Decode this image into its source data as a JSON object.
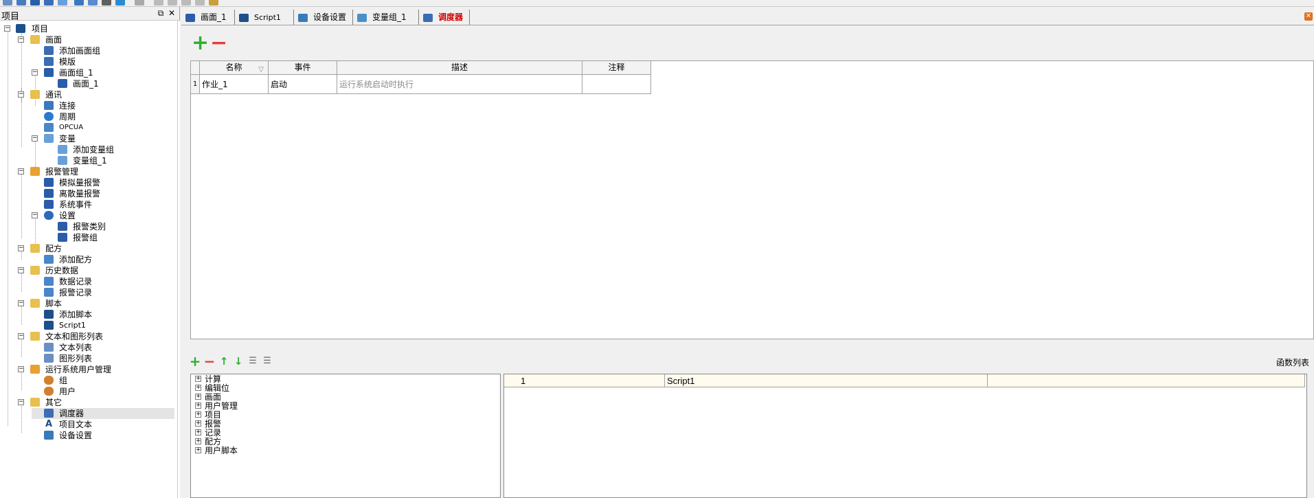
{
  "left_pane": {
    "title": "项目",
    "restore_icon": "restore-icon",
    "close_icon": "close-icon"
  },
  "tree": {
    "root": "项目",
    "screens": "画面",
    "add_screen_group": "添加画面组",
    "template": "模版",
    "screen_group_1": "画面组_1",
    "screen_1": "画面_1",
    "comm": "通讯",
    "connection": "连接",
    "cycle": "周期",
    "opcua": "OPCUA",
    "variables": "变量",
    "add_var_group": "添加变量组",
    "var_group_1": "变量组_1",
    "alarm_mgmt": "报警管理",
    "analog_alarm": "模拟量报警",
    "discrete_alarm": "离散量报警",
    "system_event": "系统事件",
    "settings": "设置",
    "alarm_class": "报警类别",
    "alarm_group": "报警组",
    "recipe": "配方",
    "add_recipe": "添加配方",
    "history": "历史数据",
    "data_log": "数据记录",
    "alarm_log": "报警记录",
    "script": "脚本",
    "add_script": "添加脚本",
    "script1": "Script1",
    "text_graphic_list": "文本和图形列表",
    "text_list": "文本列表",
    "graphic_list": "图形列表",
    "runtime_user_mgmt": "运行系统用户管理",
    "group": "组",
    "user": "用户",
    "other": "其它",
    "scheduler": "调度器",
    "project_text": "项目文本",
    "device_settings": "设备设置"
  },
  "tabs": [
    {
      "label": "画面_1",
      "icon": "screen-icon",
      "color": "#2a5caa"
    },
    {
      "label": "Script1",
      "icon": "script-icon",
      "color": "#1d4f8a"
    },
    {
      "label": "设备设置",
      "icon": "device-settings-icon",
      "color": "#3a7ab8"
    },
    {
      "label": "变量组_1",
      "icon": "variable-group-icon",
      "color": "#4a90c8"
    },
    {
      "label": "调度器",
      "icon": "scheduler-icon",
      "color": "#3a6db5"
    }
  ],
  "grid": {
    "headers": {
      "name": "名称",
      "event": "事件",
      "desc": "描述",
      "note": "注释"
    },
    "rows": [
      {
        "num": "1",
        "name": "作业_1",
        "event": "启动",
        "desc": "运行系统启动时执行",
        "note": ""
      }
    ]
  },
  "function_list": {
    "label": "函数列表",
    "categories": [
      "计算",
      "编辑位",
      "画面",
      "用户管理",
      "项目",
      "报警",
      "记录",
      "配方",
      "用户脚本"
    ],
    "row": {
      "num": "1",
      "name": "Script1",
      "extra": ""
    }
  },
  "colors": {
    "plus": "#2db02d",
    "minus": "#e33b3b",
    "active_tab": "#d00000",
    "selection_row": "#fffbee"
  }
}
